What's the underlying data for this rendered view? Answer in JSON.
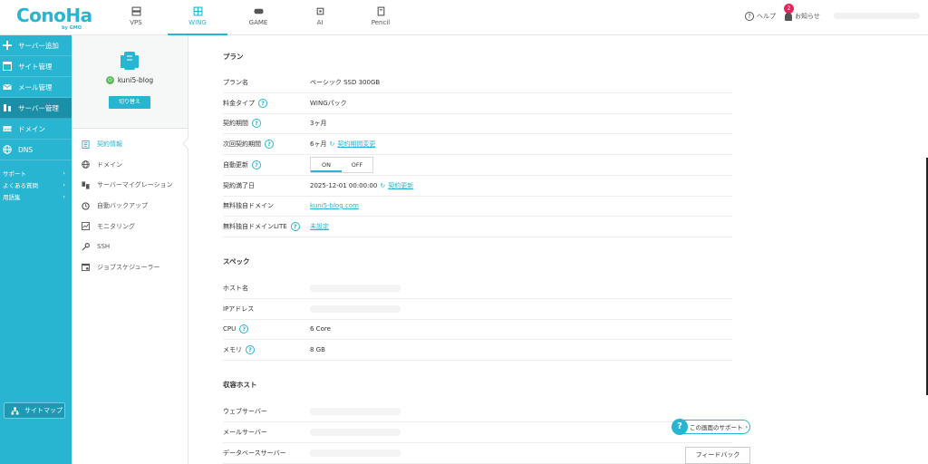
{
  "brand": {
    "logo_text": "ConoHa",
    "logo_sub": "by GMO"
  },
  "top_services": [
    {
      "label": "VPS",
      "icon": "server-icon"
    },
    {
      "label": "WING",
      "icon": "wing-icon",
      "active": true
    },
    {
      "label": "GAME",
      "icon": "gamepad-icon"
    },
    {
      "label": "AI",
      "icon": "ai-icon"
    },
    {
      "label": "Pencil",
      "icon": "pencil-icon"
    }
  ],
  "header": {
    "help": "ヘルプ",
    "notice": "お知らせ",
    "notice_count": "2"
  },
  "sidebar": {
    "items": [
      {
        "label": "サーバー追加",
        "icon": "plus-icon"
      },
      {
        "label": "サイト管理",
        "icon": "site-icon"
      },
      {
        "label": "メール管理",
        "icon": "mail-icon"
      },
      {
        "label": "サーバー管理",
        "icon": "server-manage-icon",
        "active": true
      },
      {
        "label": "ドメイン",
        "icon": "domain-icon"
      },
      {
        "label": "DNS",
        "icon": "globe-icon"
      }
    ],
    "links": [
      {
        "label": "サポート"
      },
      {
        "label": "よくある質問"
      },
      {
        "label": "用語集"
      }
    ],
    "sitemap": "サイトマップ"
  },
  "account": {
    "name": "kuni5-blog",
    "switch": "切り替え"
  },
  "subnav": [
    {
      "label": "契約情報",
      "icon": "contract-icon",
      "active": true
    },
    {
      "label": "ドメイン",
      "icon": "globe-icon"
    },
    {
      "label": "サーバーマイグレーション",
      "icon": "migration-icon"
    },
    {
      "label": "自動バックアップ",
      "icon": "backup-icon"
    },
    {
      "label": "モニタリング",
      "icon": "chart-icon"
    },
    {
      "label": "SSH",
      "icon": "key-icon"
    },
    {
      "label": "ジョブスケジューラー",
      "icon": "calendar-icon"
    }
  ],
  "plan": {
    "title": "プラン",
    "rows": {
      "plan_name": {
        "k": "プラン名",
        "v": "ベーシック  SSD 300GB"
      },
      "fee_type": {
        "k": "料金タイプ",
        "v": "WINGパック"
      },
      "term": {
        "k": "契約期間",
        "v": "3ヶ月"
      },
      "next_term": {
        "k": "次回契約期間",
        "v": "6ヶ月",
        "link": "契約期間変更"
      },
      "auto_renew": {
        "k": "自動更新",
        "on": "ON",
        "off": "OFF"
      },
      "end_date": {
        "k": "契約満了日",
        "v": "2025-12-01 00:00:00",
        "link": "契約更新"
      },
      "free_domain": {
        "k": "無料独自ドメイン",
        "v": "kuni5-blog.com"
      },
      "free_domain_lite": {
        "k": "無料独自ドメインLITE",
        "v": "未設定"
      }
    }
  },
  "spec": {
    "title": "スペック",
    "rows": {
      "host": {
        "k": "ホスト名"
      },
      "ip": {
        "k": "IPアドレス"
      },
      "cpu": {
        "k": "CPU",
        "v": "6 Core"
      },
      "mem": {
        "k": "メモリ",
        "v": "8 GB"
      }
    }
  },
  "hosts": {
    "title": "収容ホスト",
    "rows": {
      "web": {
        "k": "ウェブサーバー"
      },
      "mail": {
        "k": "メールサーバー"
      },
      "db": {
        "k": "データベースサーバー"
      }
    }
  },
  "support_label": "この画面のサポート",
  "feedback_label": "フィードバック",
  "colors": {
    "accent": "#27b5d1",
    "accent_dark": "#1a8fa7",
    "badge": "#e4255b"
  }
}
